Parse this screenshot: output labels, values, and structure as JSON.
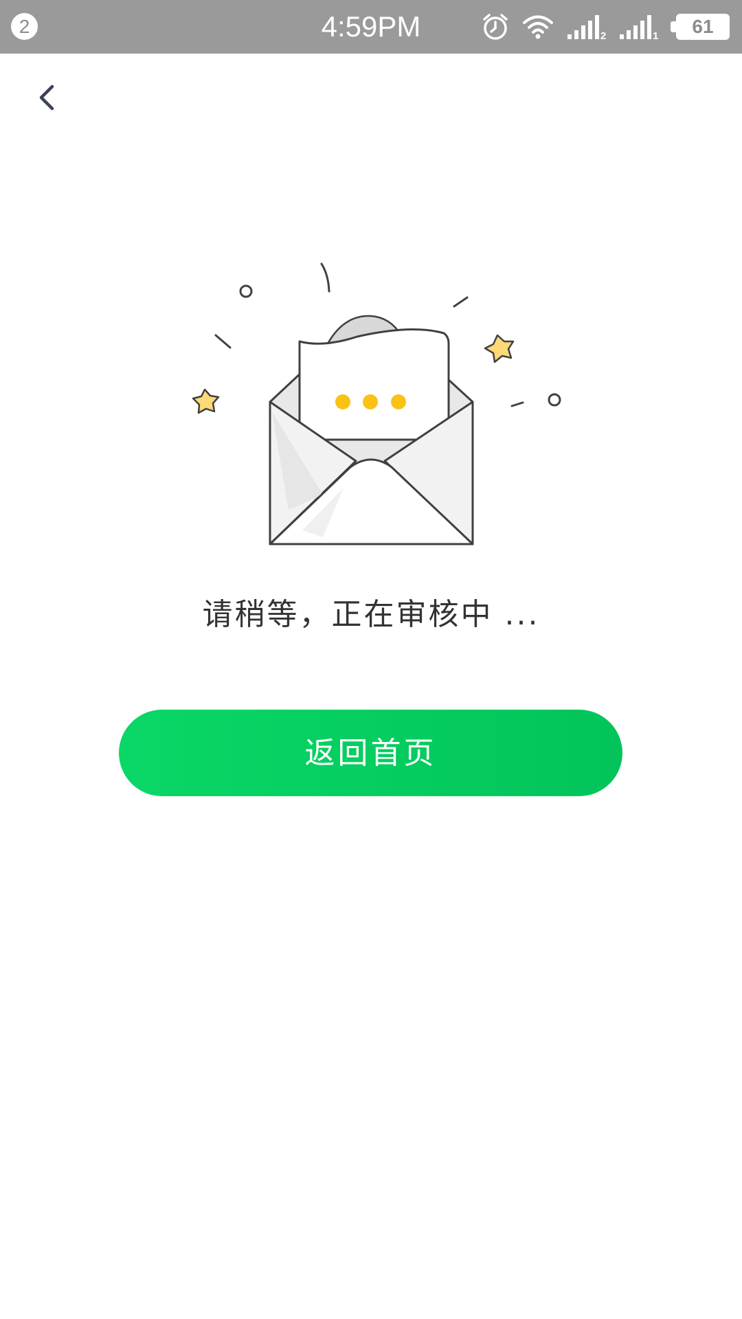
{
  "status_bar": {
    "notification_count": "2",
    "time": "4:59PM",
    "sim1_label": "2",
    "sim2_label": "1",
    "battery_level": "61",
    "icons": [
      "alarm-icon",
      "wifi-icon",
      "signal-icon",
      "signal-icon",
      "battery-icon"
    ]
  },
  "nav": {
    "back_icon": "chevron-left-icon"
  },
  "main": {
    "illustration_icon": "open-envelope-icon",
    "message": "请稍等，正在审核中 ...",
    "home_button_label": "返回首页"
  },
  "colors": {
    "status_bar": "#9a9a9a",
    "button_start": "#09d766",
    "button_end": "#02c45a",
    "dots": "#fbc216",
    "stars": "#fdd977",
    "text": "#333333"
  }
}
